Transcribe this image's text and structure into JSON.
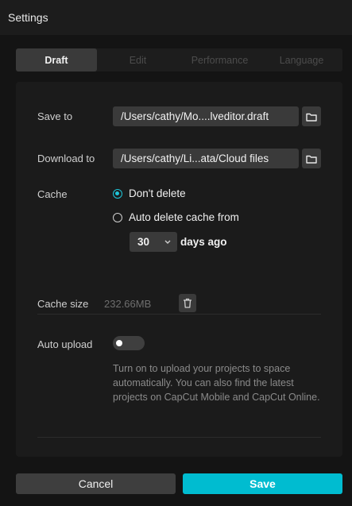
{
  "window": {
    "title": "Settings"
  },
  "tabs": [
    {
      "label": "Draft",
      "active": true
    },
    {
      "label": "Edit",
      "active": false
    },
    {
      "label": "Performance",
      "active": false
    },
    {
      "label": "Language",
      "active": false
    }
  ],
  "draft": {
    "save_to": {
      "label": "Save to",
      "value": "/Users/cathy/Mo....lveditor.draft",
      "icon": "folder-icon"
    },
    "download_to": {
      "label": "Download to",
      "value": "/Users/cathy/Li...ata/Cloud files",
      "icon": "folder-icon"
    },
    "cache": {
      "label": "Cache",
      "options": [
        {
          "label": "Don't delete",
          "checked": true
        },
        {
          "label": "Auto delete cache from",
          "checked": false
        }
      ],
      "days_value": "30",
      "days_suffix": "days ago"
    },
    "cache_size": {
      "label": "Cache size",
      "value": "232.66MB",
      "icon": "trash-icon"
    },
    "auto_upload": {
      "label": "Auto upload",
      "enabled": false,
      "description": "Turn on to upload your projects to space automatically. You can also find the latest projects on CapCut Mobile and CapCut Online."
    }
  },
  "footer": {
    "cancel_label": "Cancel",
    "save_label": "Save"
  },
  "colors": {
    "accent": "#00bcd0",
    "background": "#141414",
    "panel": "#1b1b1b"
  }
}
